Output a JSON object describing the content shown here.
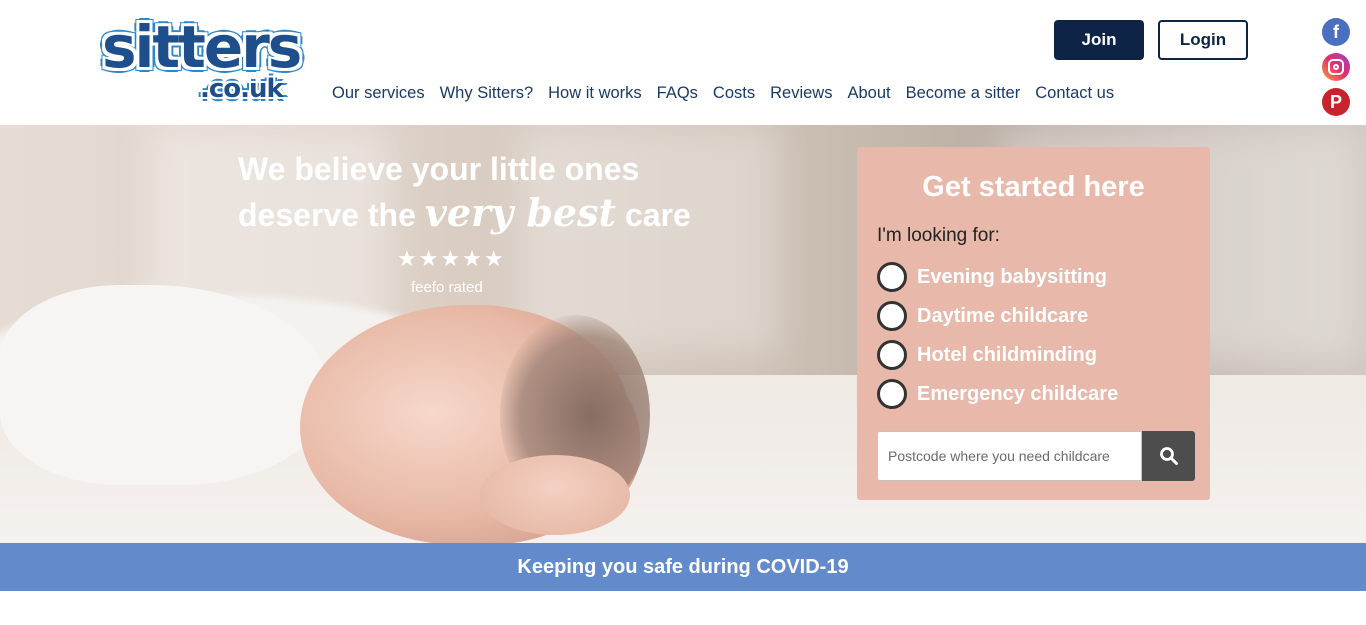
{
  "header": {
    "logo_main": "sitters",
    "logo_sub": ".co.uk",
    "join_label": "Join",
    "login_label": "Login",
    "nav": [
      {
        "label": "Our services"
      },
      {
        "label": "Why Sitters?"
      },
      {
        "label": "How it works"
      },
      {
        "label": "FAQs"
      },
      {
        "label": "Costs"
      },
      {
        "label": "Reviews"
      },
      {
        "label": "About"
      },
      {
        "label": "Become a sitter"
      },
      {
        "label": "Contact us"
      }
    ],
    "social": {
      "facebook_glyph": "f",
      "pinterest_glyph": "P"
    }
  },
  "hero": {
    "line1": "We believe your little ones",
    "line2_prefix": "deserve the ",
    "line2_script": "very best",
    "line2_suffix": " care",
    "stars": "★★★★★",
    "rating_text": "feefo rated"
  },
  "panel": {
    "title": "Get started here",
    "subtitle": "I'm looking for:",
    "options": [
      {
        "label": "Evening babysitting"
      },
      {
        "label": "Daytime childcare"
      },
      {
        "label": "Hotel childminding"
      },
      {
        "label": "Emergency childcare"
      }
    ],
    "search_placeholder": "Postcode where you need childcare"
  },
  "covid_banner": "Keeping you safe during COVID-19",
  "colors": {
    "brand_navy": "#0d2447",
    "panel_pink": "#e8b9ab",
    "covid_blue": "#638bcb"
  }
}
